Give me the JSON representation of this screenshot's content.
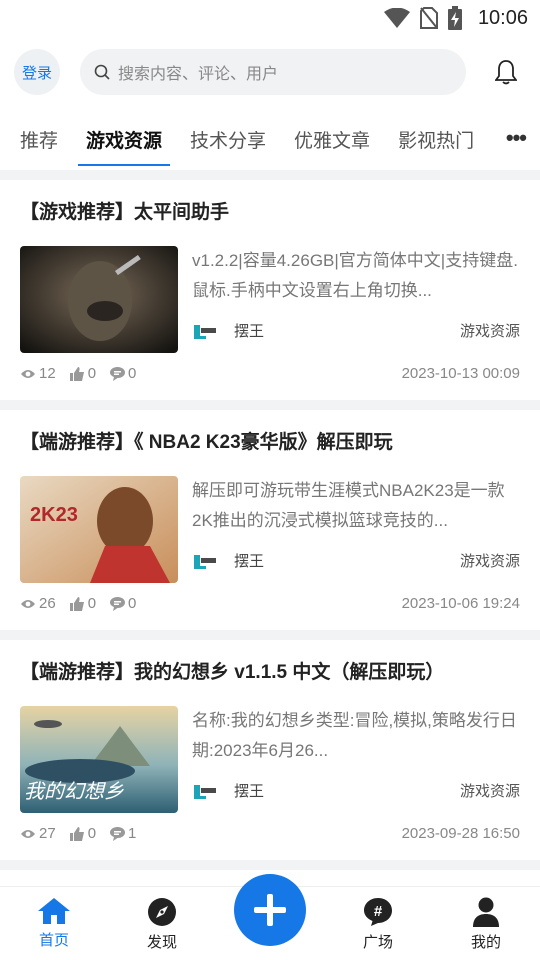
{
  "status_bar": {
    "time": "10:06",
    "icons": [
      "wifi-icon",
      "no-sim-icon",
      "battery-charging-icon"
    ]
  },
  "header": {
    "login_label": "登录",
    "search_placeholder": "搜索内容、评论、用户",
    "bell_icon": "bell-icon"
  },
  "tabs": [
    {
      "label": "推荐",
      "active": false
    },
    {
      "label": "游戏资源",
      "active": true
    },
    {
      "label": "技术分享",
      "active": false
    },
    {
      "label": "优雅文章",
      "active": false
    },
    {
      "label": "影视热门",
      "active": false
    }
  ],
  "tabs_more": "•••",
  "posts": [
    {
      "title": "【游戏推荐】太平间助手",
      "excerpt": "v1.2.2|容量4.26GB|官方简体中文|支持键盘.鼠标.手柄中文设置右上角切换...",
      "author": "摆王",
      "category": "游戏资源",
      "views": "12",
      "likes": "0",
      "comments": "0",
      "date": "2023-10-13 00:09",
      "thumb_text": ""
    },
    {
      "title": "【端游推荐】《 NBA2 K23豪华版》解压即玩",
      "excerpt": "解压即可游玩带生涯模式NBA2K23是一款2K推出的沉浸式模拟篮球竞技的...",
      "author": "摆王",
      "category": "游戏资源",
      "views": "26",
      "likes": "0",
      "comments": "0",
      "date": "2023-10-06 19:24",
      "thumb_text": "2K23"
    },
    {
      "title": "【端游推荐】我的幻想乡 v1.1.5 中文（解压即玩）",
      "excerpt": "名称:我的幻想乡类型:冒险,模拟,策略发行日期:2023年6月26...",
      "author": "摆王",
      "category": "游戏资源",
      "views": "27",
      "likes": "0",
      "comments": "1",
      "date": "2023-09-28 16:50",
      "thumb_text": "我的幻想乡"
    }
  ],
  "bottom_nav": [
    {
      "label": "首页",
      "icon": "home-icon",
      "active": true
    },
    {
      "label": "发现",
      "icon": "compass-icon",
      "active": false
    },
    {
      "label": "广场",
      "icon": "hashtag-chat-icon",
      "active": false
    },
    {
      "label": "我的",
      "icon": "user-icon",
      "active": false
    }
  ],
  "fab_icon": "plus-icon",
  "colors": {
    "accent": "#1677e6"
  }
}
